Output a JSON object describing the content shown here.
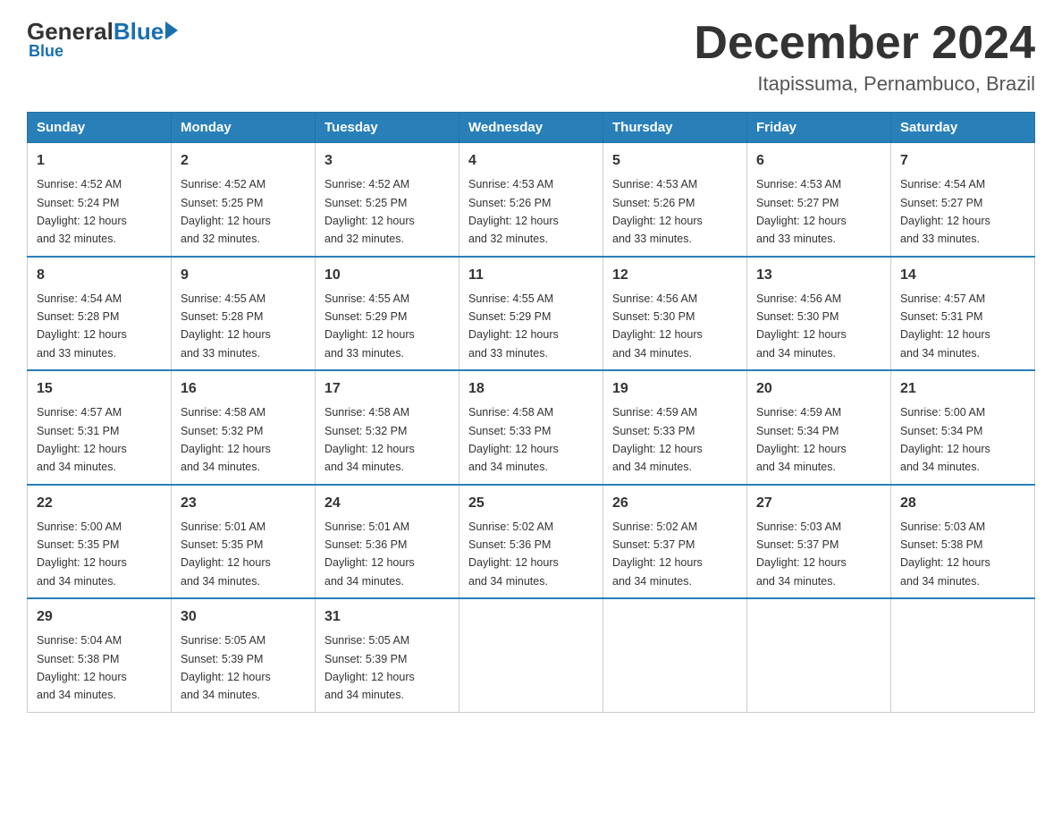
{
  "logo": {
    "general": "General",
    "blue": "Blue",
    "underline": "Blue"
  },
  "title": "December 2024",
  "location": "Itapissuma, Pernambuco, Brazil",
  "days_of_week": [
    "Sunday",
    "Monday",
    "Tuesday",
    "Wednesday",
    "Thursday",
    "Friday",
    "Saturday"
  ],
  "weeks": [
    [
      {
        "day": "1",
        "sunrise": "4:52 AM",
        "sunset": "5:24 PM",
        "daylight": "12 hours and 32 minutes."
      },
      {
        "day": "2",
        "sunrise": "4:52 AM",
        "sunset": "5:25 PM",
        "daylight": "12 hours and 32 minutes."
      },
      {
        "day": "3",
        "sunrise": "4:52 AM",
        "sunset": "5:25 PM",
        "daylight": "12 hours and 32 minutes."
      },
      {
        "day": "4",
        "sunrise": "4:53 AM",
        "sunset": "5:26 PM",
        "daylight": "12 hours and 32 minutes."
      },
      {
        "day": "5",
        "sunrise": "4:53 AM",
        "sunset": "5:26 PM",
        "daylight": "12 hours and 33 minutes."
      },
      {
        "day": "6",
        "sunrise": "4:53 AM",
        "sunset": "5:27 PM",
        "daylight": "12 hours and 33 minutes."
      },
      {
        "day": "7",
        "sunrise": "4:54 AM",
        "sunset": "5:27 PM",
        "daylight": "12 hours and 33 minutes."
      }
    ],
    [
      {
        "day": "8",
        "sunrise": "4:54 AM",
        "sunset": "5:28 PM",
        "daylight": "12 hours and 33 minutes."
      },
      {
        "day": "9",
        "sunrise": "4:55 AM",
        "sunset": "5:28 PM",
        "daylight": "12 hours and 33 minutes."
      },
      {
        "day": "10",
        "sunrise": "4:55 AM",
        "sunset": "5:29 PM",
        "daylight": "12 hours and 33 minutes."
      },
      {
        "day": "11",
        "sunrise": "4:55 AM",
        "sunset": "5:29 PM",
        "daylight": "12 hours and 33 minutes."
      },
      {
        "day": "12",
        "sunrise": "4:56 AM",
        "sunset": "5:30 PM",
        "daylight": "12 hours and 34 minutes."
      },
      {
        "day": "13",
        "sunrise": "4:56 AM",
        "sunset": "5:30 PM",
        "daylight": "12 hours and 34 minutes."
      },
      {
        "day": "14",
        "sunrise": "4:57 AM",
        "sunset": "5:31 PM",
        "daylight": "12 hours and 34 minutes."
      }
    ],
    [
      {
        "day": "15",
        "sunrise": "4:57 AM",
        "sunset": "5:31 PM",
        "daylight": "12 hours and 34 minutes."
      },
      {
        "day": "16",
        "sunrise": "4:58 AM",
        "sunset": "5:32 PM",
        "daylight": "12 hours and 34 minutes."
      },
      {
        "day": "17",
        "sunrise": "4:58 AM",
        "sunset": "5:32 PM",
        "daylight": "12 hours and 34 minutes."
      },
      {
        "day": "18",
        "sunrise": "4:58 AM",
        "sunset": "5:33 PM",
        "daylight": "12 hours and 34 minutes."
      },
      {
        "day": "19",
        "sunrise": "4:59 AM",
        "sunset": "5:33 PM",
        "daylight": "12 hours and 34 minutes."
      },
      {
        "day": "20",
        "sunrise": "4:59 AM",
        "sunset": "5:34 PM",
        "daylight": "12 hours and 34 minutes."
      },
      {
        "day": "21",
        "sunrise": "5:00 AM",
        "sunset": "5:34 PM",
        "daylight": "12 hours and 34 minutes."
      }
    ],
    [
      {
        "day": "22",
        "sunrise": "5:00 AM",
        "sunset": "5:35 PM",
        "daylight": "12 hours and 34 minutes."
      },
      {
        "day": "23",
        "sunrise": "5:01 AM",
        "sunset": "5:35 PM",
        "daylight": "12 hours and 34 minutes."
      },
      {
        "day": "24",
        "sunrise": "5:01 AM",
        "sunset": "5:36 PM",
        "daylight": "12 hours and 34 minutes."
      },
      {
        "day": "25",
        "sunrise": "5:02 AM",
        "sunset": "5:36 PM",
        "daylight": "12 hours and 34 minutes."
      },
      {
        "day": "26",
        "sunrise": "5:02 AM",
        "sunset": "5:37 PM",
        "daylight": "12 hours and 34 minutes."
      },
      {
        "day": "27",
        "sunrise": "5:03 AM",
        "sunset": "5:37 PM",
        "daylight": "12 hours and 34 minutes."
      },
      {
        "day": "28",
        "sunrise": "5:03 AM",
        "sunset": "5:38 PM",
        "daylight": "12 hours and 34 minutes."
      }
    ],
    [
      {
        "day": "29",
        "sunrise": "5:04 AM",
        "sunset": "5:38 PM",
        "daylight": "12 hours and 34 minutes."
      },
      {
        "day": "30",
        "sunrise": "5:05 AM",
        "sunset": "5:39 PM",
        "daylight": "12 hours and 34 minutes."
      },
      {
        "day": "31",
        "sunrise": "5:05 AM",
        "sunset": "5:39 PM",
        "daylight": "12 hours and 34 minutes."
      },
      null,
      null,
      null,
      null
    ]
  ],
  "labels": {
    "sunrise": "Sunrise:",
    "sunset": "Sunset:",
    "daylight": "Daylight:"
  }
}
